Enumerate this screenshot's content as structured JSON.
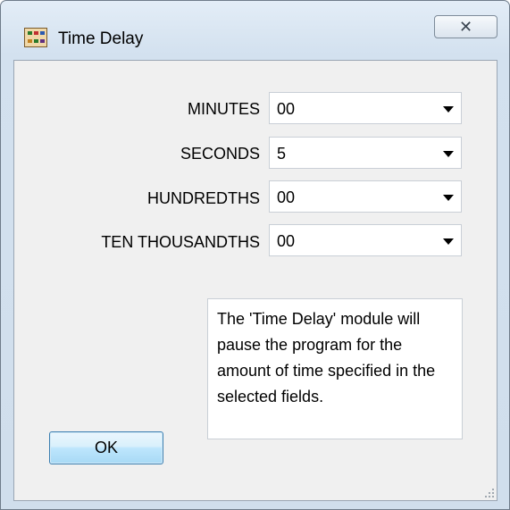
{
  "window": {
    "title": "Time Delay",
    "close_symbol": "✕",
    "app_icon": "app-icon"
  },
  "fields": [
    {
      "label": "MINUTES",
      "value": "00"
    },
    {
      "label": "SECONDS",
      "value": "5"
    },
    {
      "label": "HUNDREDTHS",
      "value": "00"
    },
    {
      "label": "TEN THOUSANDTHS",
      "value": "00"
    }
  ],
  "description": "The 'Time Delay' module will pause the program for the amount of time specified in the selected fields.",
  "ok_label": "OK"
}
